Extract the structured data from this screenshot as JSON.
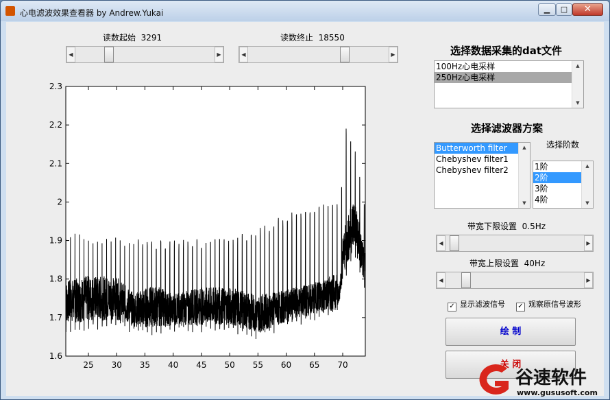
{
  "window": {
    "title": "心电滤波效果查看器 by Andrew.Yukai",
    "controls": {
      "minimize": "▁",
      "maximize": "□",
      "close": "✕"
    }
  },
  "sliders": {
    "read_start": {
      "label": "读数起始",
      "value": "3291",
      "position": 0.22
    },
    "read_end": {
      "label": "读数终止",
      "value": "18550",
      "position": 0.7
    },
    "band_low": {
      "label": "带宽下限设置",
      "value": "0.5Hz",
      "position": 0.03
    },
    "band_high": {
      "label": "带宽上限设置",
      "value": "40Hz",
      "position": 0.12
    }
  },
  "data_files": {
    "heading": "选择数据采集的dat文件",
    "items": [
      "100Hz心电采样",
      "250Hz心电采样"
    ],
    "selected_index": 1
  },
  "filters": {
    "heading": "选择滤波器方案",
    "items": [
      "Butterworth filter",
      "Chebyshev filter1",
      "Chebyshev filter2"
    ],
    "selected_index": 0
  },
  "orders": {
    "label": "选择阶数",
    "items": [
      "1阶",
      "2阶",
      "3阶",
      "4阶"
    ],
    "selected_index": 1
  },
  "checkboxes": {
    "show_filtered": {
      "label": "显示滤波信号",
      "checked": true
    },
    "show_original": {
      "label": "观察原信号波形",
      "checked": true
    }
  },
  "buttons": {
    "draw": "绘 制",
    "close": "关 闭"
  },
  "watermark": {
    "brand": "谷速软件",
    "url": "www.gususoft.com"
  },
  "colors": {
    "selection_blue": "#3399ff",
    "selection_grey": "#a8a8a8",
    "button_text": "#0000cc",
    "signal": "#000000"
  },
  "chart_data": {
    "type": "line",
    "xlabel": "",
    "ylabel": "",
    "xlim": [
      21,
      74
    ],
    "ylim": [
      1.6,
      2.3
    ],
    "xticks": [
      25,
      30,
      35,
      40,
      45,
      50,
      55,
      60,
      65,
      70
    ],
    "yticks": [
      1.6,
      1.7,
      1.8,
      1.9,
      2.0,
      2.1,
      2.2,
      2.3
    ],
    "grid": false,
    "signal": {
      "description": "ECG trace with periodic R-peaks",
      "r_peak_interval_x": 0.8,
      "baseline_points": [
        [
          21,
          1.74
        ],
        [
          25,
          1.75
        ],
        [
          30,
          1.75
        ],
        [
          33,
          1.72
        ],
        [
          37,
          1.73
        ],
        [
          40,
          1.72
        ],
        [
          45,
          1.73
        ],
        [
          50,
          1.73
        ],
        [
          55,
          1.71
        ],
        [
          60,
          1.73
        ],
        [
          65,
          1.75
        ],
        [
          69.5,
          1.77
        ],
        [
          70,
          1.86
        ],
        [
          72,
          1.95
        ],
        [
          74,
          1.82
        ]
      ],
      "peak_points": [
        [
          21,
          1.92
        ],
        [
          30,
          1.91
        ],
        [
          40,
          1.9
        ],
        [
          50,
          1.91
        ],
        [
          55,
          1.93
        ],
        [
          60,
          1.97
        ],
        [
          65,
          2.0
        ],
        [
          69.5,
          2.0
        ],
        [
          70.5,
          2.2
        ],
        [
          72,
          2.15
        ],
        [
          74,
          2.0
        ]
      ],
      "trough_points": [
        [
          21,
          1.66
        ],
        [
          30,
          1.67
        ],
        [
          35,
          1.65
        ],
        [
          40,
          1.66
        ],
        [
          50,
          1.66
        ],
        [
          55,
          1.64
        ],
        [
          60,
          1.67
        ],
        [
          65,
          1.69
        ],
        [
          69,
          1.7
        ],
        [
          70,
          1.78
        ],
        [
          72,
          1.85
        ],
        [
          74,
          1.76
        ]
      ]
    }
  }
}
